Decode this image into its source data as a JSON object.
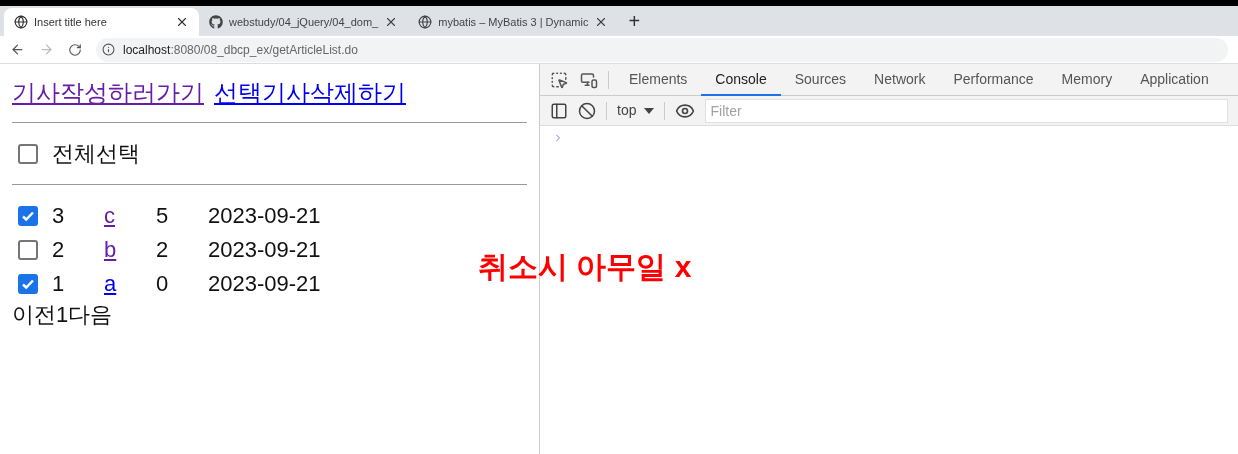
{
  "browser": {
    "tabs": [
      {
        "title": "Insert title here",
        "kind": "page",
        "selected": true
      },
      {
        "title": "webstudy/04_jQuery/04_dom_",
        "kind": "repository",
        "selected": false
      },
      {
        "title": "mybatis – MyBatis 3 | Dynamic",
        "kind": "page",
        "selected": false
      }
    ],
    "new_tab": "+",
    "url_host": "localhost",
    "url_rest": ":8080/08_dbcp_ex/getArticleList.do"
  },
  "page": {
    "links": [
      {
        "text": "기사작성하러가기",
        "visited": true
      },
      {
        "text": "선택기사삭제하기",
        "visited": false
      }
    ],
    "select_all": {
      "label": "전체선택",
      "checked": false
    },
    "rows": [
      {
        "checked": true,
        "no": "3",
        "title": "c",
        "visited": true,
        "count": "5",
        "date": "2023-09-21"
      },
      {
        "checked": false,
        "no": "2",
        "title": "b",
        "visited": true,
        "count": "2",
        "date": "2023-09-21"
      },
      {
        "checked": true,
        "no": "1",
        "title": "a",
        "visited": false,
        "count": "0",
        "date": "2023-09-21"
      }
    ],
    "pager": "이전1다음"
  },
  "devtools": {
    "tabs": [
      {
        "label": "Elements",
        "selected": false
      },
      {
        "label": "Console",
        "selected": true
      },
      {
        "label": "Sources",
        "selected": false
      },
      {
        "label": "Network",
        "selected": false
      },
      {
        "label": "Performance",
        "selected": false
      },
      {
        "label": "Memory",
        "selected": false
      },
      {
        "label": "Application",
        "selected": false
      }
    ],
    "context": "top",
    "filter_placeholder": "Filter"
  },
  "annotation": "취소시 아무일 x"
}
